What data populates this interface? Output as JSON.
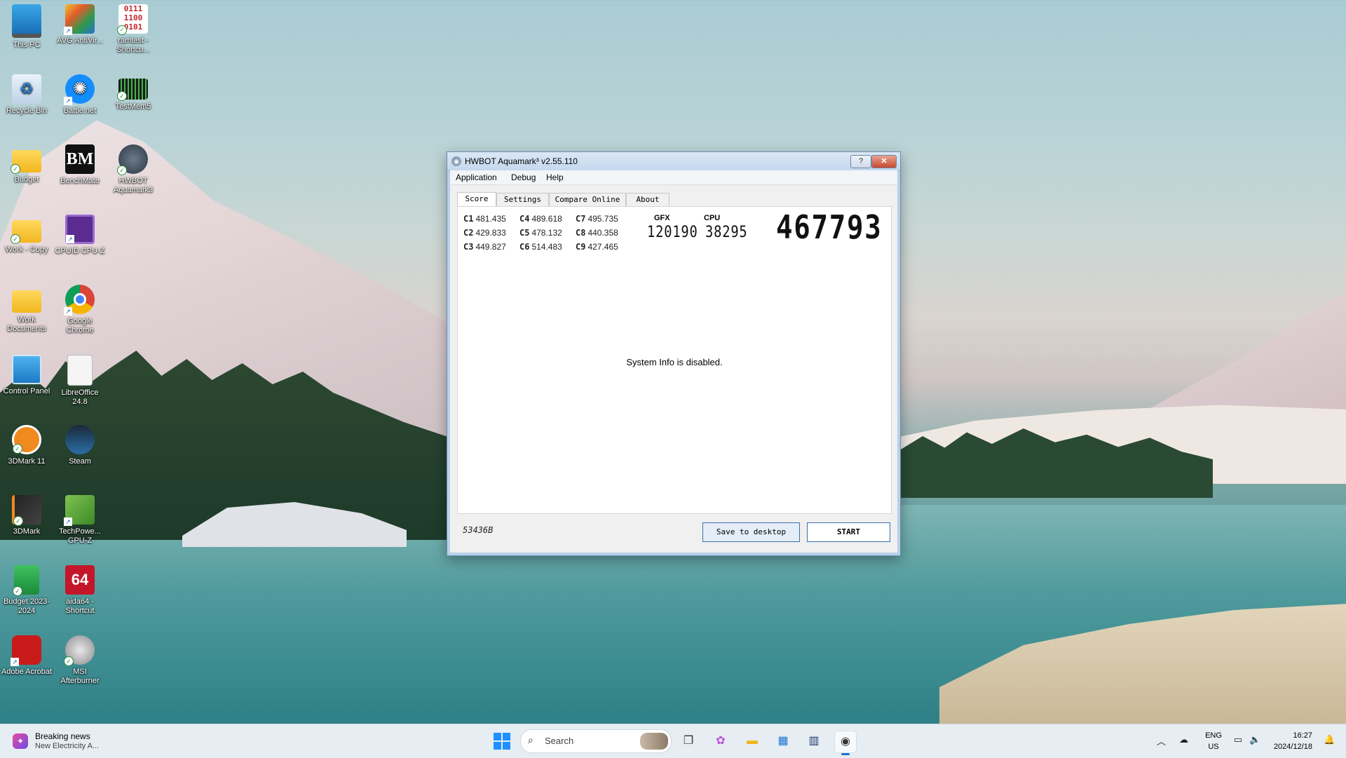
{
  "desktop": {
    "icons": [
      {
        "label": "This PC",
        "icon": "monitor-icon"
      },
      {
        "label": "AVG AntiVir...",
        "icon": "avg-icon"
      },
      {
        "label": "ramtest - Shortcu...",
        "icon": "ramtest-icon"
      },
      {
        "label": "Recycle Bin",
        "icon": "recycle-bin-icon"
      },
      {
        "label": "Battle.net",
        "icon": "battlenet-icon"
      },
      {
        "label": "TestMem5",
        "icon": "testmem-icon"
      },
      {
        "label": "Budget",
        "icon": "folder-icon"
      },
      {
        "label": "BenchMate",
        "icon": "benchmate-icon"
      },
      {
        "label": "HWBOT Aquamark3",
        "icon": "aquamark-icon"
      },
      {
        "label": "Work - Copy",
        "icon": "folder-icon"
      },
      {
        "label": "CPUID CPU-Z",
        "icon": "cpuz-icon"
      },
      {
        "label": "Work Documents",
        "icon": "folder-icon"
      },
      {
        "label": "Google Chrome",
        "icon": "chrome-icon"
      },
      {
        "label": "Control Panel",
        "icon": "control-panel-icon"
      },
      {
        "label": "LibreOffice 24.8",
        "icon": "document-icon"
      },
      {
        "label": "3DMark 11",
        "icon": "3dmark11-icon"
      },
      {
        "label": "Steam",
        "icon": "steam-icon"
      },
      {
        "label": "3DMark",
        "icon": "3dmark-icon"
      },
      {
        "label": "TechPowe... GPU-Z",
        "icon": "gpuz-icon"
      },
      {
        "label": "Budget 2023-2024",
        "icon": "spreadsheet-icon"
      },
      {
        "label": "aida64 - Shortcut",
        "icon": "aida64-icon"
      },
      {
        "label": "Adobe Acrobat",
        "icon": "acrobat-icon"
      },
      {
        "label": "MSI Afterburner",
        "icon": "afterburner-icon"
      }
    ]
  },
  "window": {
    "title": "HWBOT Aquamark³ v2.55.110",
    "help_label": "?",
    "close_label": "✕",
    "menu": [
      "Application",
      "Debug",
      "Help"
    ],
    "tabs": [
      "Score",
      "Settings",
      "Compare Online",
      "About"
    ],
    "scores": [
      {
        "id": "C1",
        "value": "481.435"
      },
      {
        "id": "C2",
        "value": "429.833"
      },
      {
        "id": "C3",
        "value": "449.827"
      },
      {
        "id": "C4",
        "value": "489.618"
      },
      {
        "id": "C5",
        "value": "478.132"
      },
      {
        "id": "C6",
        "value": "514.483"
      },
      {
        "id": "C7",
        "value": "495.735"
      },
      {
        "id": "C8",
        "value": "440.358"
      },
      {
        "id": "C9",
        "value": "427.465"
      }
    ],
    "gfx_label": "GFX",
    "gfx_value": "120190",
    "cpu_label": "CPU",
    "cpu_value": "38295",
    "total_score": "467793",
    "system_info": "System Info is disabled.",
    "serial": "53436B",
    "save_label": "Save to desktop",
    "start_label": "START"
  },
  "taskbar": {
    "news_title": "Breaking news",
    "news_sub": "New Electricity A...",
    "search_label": "Search",
    "lang_top": "ENG",
    "lang_bottom": "US",
    "time": "16:27",
    "date": "2024/12/18"
  }
}
